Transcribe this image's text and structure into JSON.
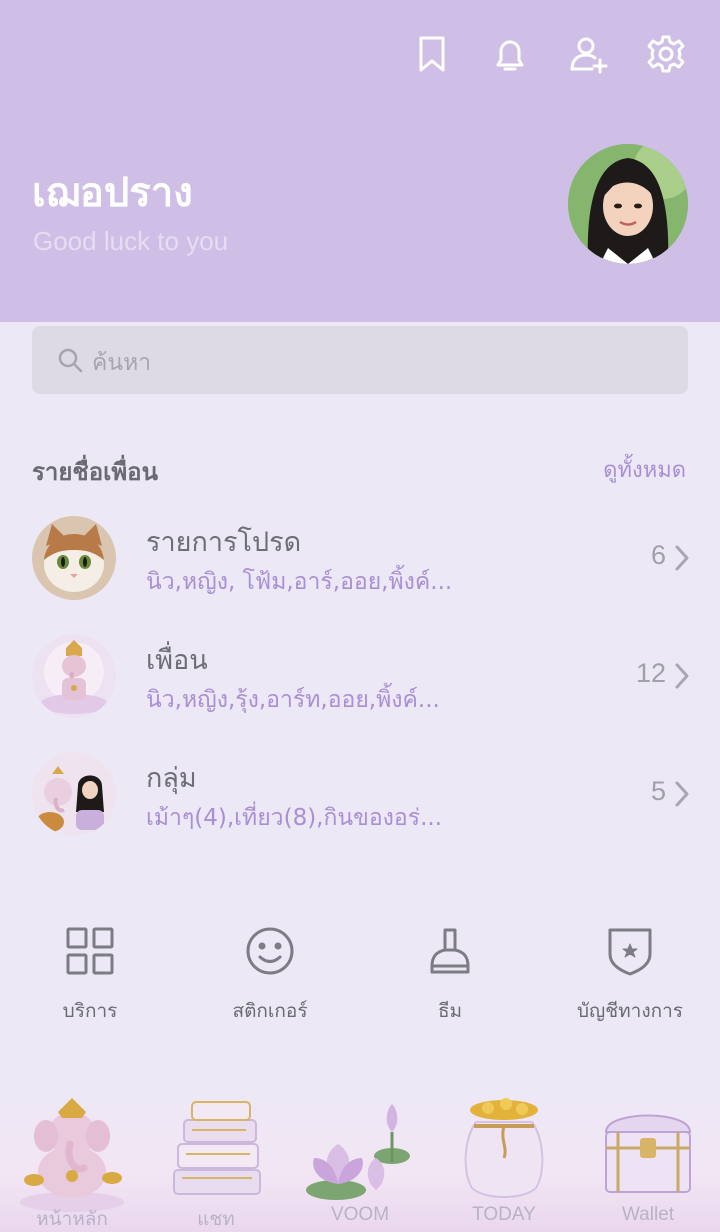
{
  "header": {
    "name": "เฌอปราง",
    "status": "Good luck to you",
    "icons": [
      "bookmark-icon",
      "bell-icon",
      "add-friend-icon",
      "gear-icon"
    ],
    "background": "#CFBFE6"
  },
  "search": {
    "placeholder": "ค้นหา"
  },
  "friends": {
    "title": "รายชื่อเพื่อน",
    "see_all": "ดูทั้งหมด",
    "rows": [
      {
        "title": "รายการโปรด",
        "subtitle": "นิว,หญิง, โฟ้ม,อาร์,ออย,พิ้งค์...",
        "count": "6"
      },
      {
        "title": "เพื่อน",
        "subtitle": "นิว,หญิง,รุ้ง,อาร์ท,ออย,พิ้งค์...",
        "count": "12"
      },
      {
        "title": "กลุ่ม",
        "subtitle": "เม้าๆ(4),เที่ยว(8),กินของอร่...",
        "count": "5"
      }
    ]
  },
  "services": [
    {
      "label": "บริการ",
      "icon": "grid-icon"
    },
    {
      "label": "สติกเกอร์",
      "icon": "smiley-icon"
    },
    {
      "label": "ธีม",
      "icon": "brush-icon"
    },
    {
      "label": "บัญชีทางการ",
      "icon": "shield-star-icon"
    }
  ],
  "bottom_nav": [
    {
      "label": "หน้าหลัก",
      "icon": "ganesha-icon"
    },
    {
      "label": "แชท",
      "icon": "books-icon"
    },
    {
      "label": "VOOM",
      "icon": "lotus-icon"
    },
    {
      "label": "TODAY",
      "icon": "money-bag-icon"
    },
    {
      "label": "Wallet",
      "icon": "treasure-chest-icon"
    }
  ],
  "colors": {
    "accent": "#A98FD3",
    "background": "#ECE8F6"
  }
}
